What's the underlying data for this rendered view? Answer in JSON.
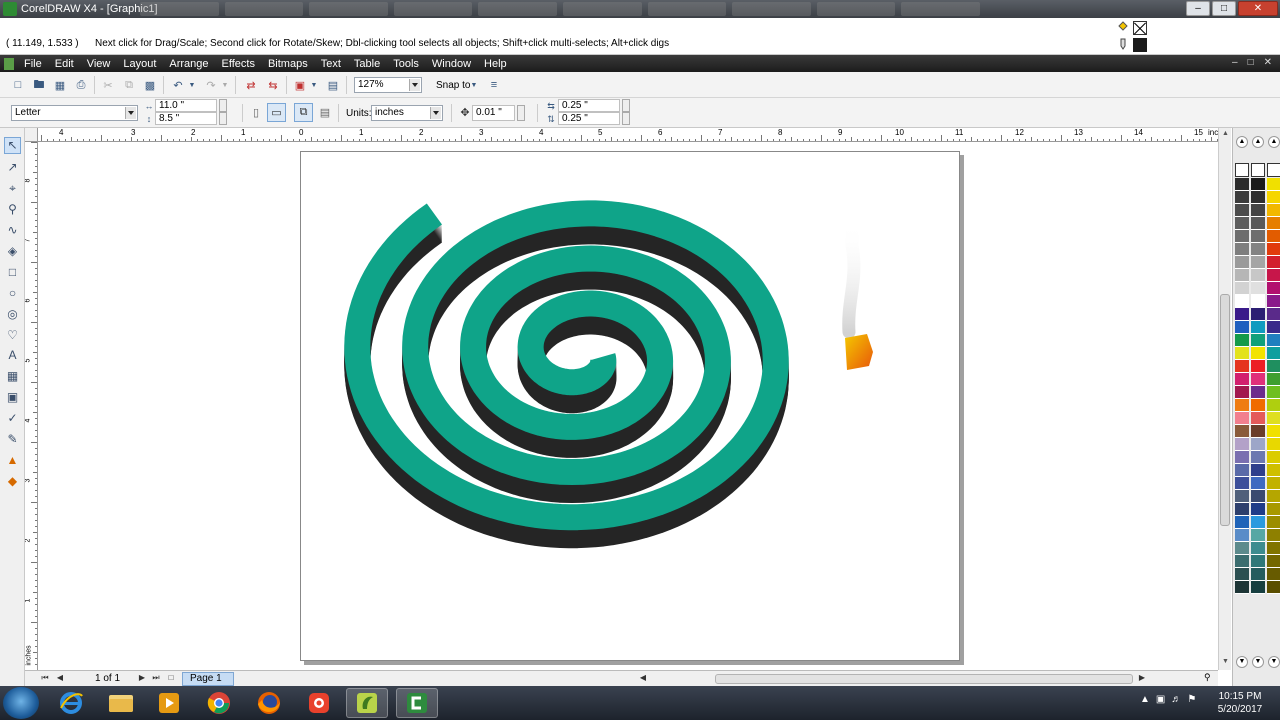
{
  "window": {
    "title": "CorelDRAW X4 - [Graphic1]"
  },
  "hint_bar": {
    "coordinates": "( 11.149, 1.533 )",
    "hint": "Next click for Drag/Scale; Second click for Rotate/Skew; Dbl-clicking tool selects all objects; Shift+click multi-selects; Alt+click digs"
  },
  "menu": {
    "items": [
      "File",
      "Edit",
      "View",
      "Layout",
      "Arrange",
      "Effects",
      "Bitmaps",
      "Text",
      "Table",
      "Tools",
      "Window",
      "Help"
    ]
  },
  "standard_toolbar": {
    "zoom": "127%",
    "snap_to": "Snap to"
  },
  "property_bar": {
    "paper": "Letter",
    "width": "11.0 \"",
    "height": "8.5 \"",
    "units_label": "Units:",
    "units": "inches",
    "nudge": "0.01 \"",
    "dup_x": "0.25 \"",
    "dup_y": "0.25 \""
  },
  "ruler": {
    "h_labels": [
      "4",
      "3",
      "2",
      "1",
      "0",
      "1",
      "2",
      "3",
      "4",
      "5",
      "6",
      "7",
      "8",
      "9",
      "10",
      "11",
      "12",
      "13",
      "14",
      "15"
    ],
    "unit": "inches",
    "v_labels": [
      "8",
      "7",
      "6",
      "5",
      "4",
      "3",
      "2",
      "1"
    ],
    "v_unit": "inches"
  },
  "document_nav": {
    "page_count": "1 of 1",
    "page_tab": "Page 1"
  },
  "colors": {
    "coil": "#0fa489",
    "shadow": "#2e2e2e",
    "flame_top": "#f4c900",
    "flame_bottom": "#e8560a"
  },
  "palette": {
    "col1": [
      "#2b2b2b",
      "#3c3c3c",
      "#4c4c4c",
      "#5d5d5d",
      "#6d6d6d",
      "#7e7e7e",
      "#9a9a9a",
      "#b6b6b6",
      "#d2d2d2",
      "#ffffff",
      "#3a1a8a",
      "#1f5fbf",
      "#149a4a",
      "#e3e21c",
      "#e5341e",
      "#d21f6e",
      "#a2184f",
      "#ef7c12",
      "#f27f8e",
      "#8a5a3a",
      "#b3a1c8",
      "#7a6fb0",
      "#5a6aa8",
      "#3d4f9a",
      "#4f5f7a",
      "#2d3f6d",
      "#1f63b8",
      "#5a8cc8",
      "#5c8a8c",
      "#3b6d6f",
      "#2b4f51",
      "#1d3536"
    ],
    "col2": [
      "#1a1a1a",
      "#2f2f2f",
      "#444444",
      "#595959",
      "#6e6e6e",
      "#838383",
      "#a5a5a5",
      "#c7c7c7",
      "#e0e0e0",
      "#ffffff",
      "#2c1f73",
      "#0e9bbf",
      "#10a07a",
      "#f2e300",
      "#ec1e24",
      "#e0307a",
      "#6d2b8c",
      "#f06b00",
      "#e45a5a",
      "#6a3d2a",
      "#9da6c8",
      "#6c78b0",
      "#2f3f8c",
      "#3f6ac0",
      "#3a4a70",
      "#1f3c88",
      "#2a9adf",
      "#56a7a4",
      "#3d8c8f",
      "#2f7879",
      "#245c5e",
      "#173f40"
    ],
    "col3": [
      "#f0e000",
      "#f6d600",
      "#f2b800",
      "#e67e00",
      "#e25c00",
      "#e13b0c",
      "#d21f2e",
      "#c7164a",
      "#b2106f",
      "#8a1a8a",
      "#5a2a8a",
      "#3a2a8a",
      "#1f7fbf",
      "#0f9f9f",
      "#1f8f5f",
      "#3f9f2f",
      "#6fbf1f",
      "#afcf0f",
      "#dfdf1f",
      "#f0e000",
      "#e8d800",
      "#dbcc00",
      "#cfbf00",
      "#c2b200",
      "#b5a600",
      "#a89900",
      "#9b8d00",
      "#8e8000",
      "#817400",
      "#746700",
      "#675b00",
      "#5a4e00"
    ]
  }
}
